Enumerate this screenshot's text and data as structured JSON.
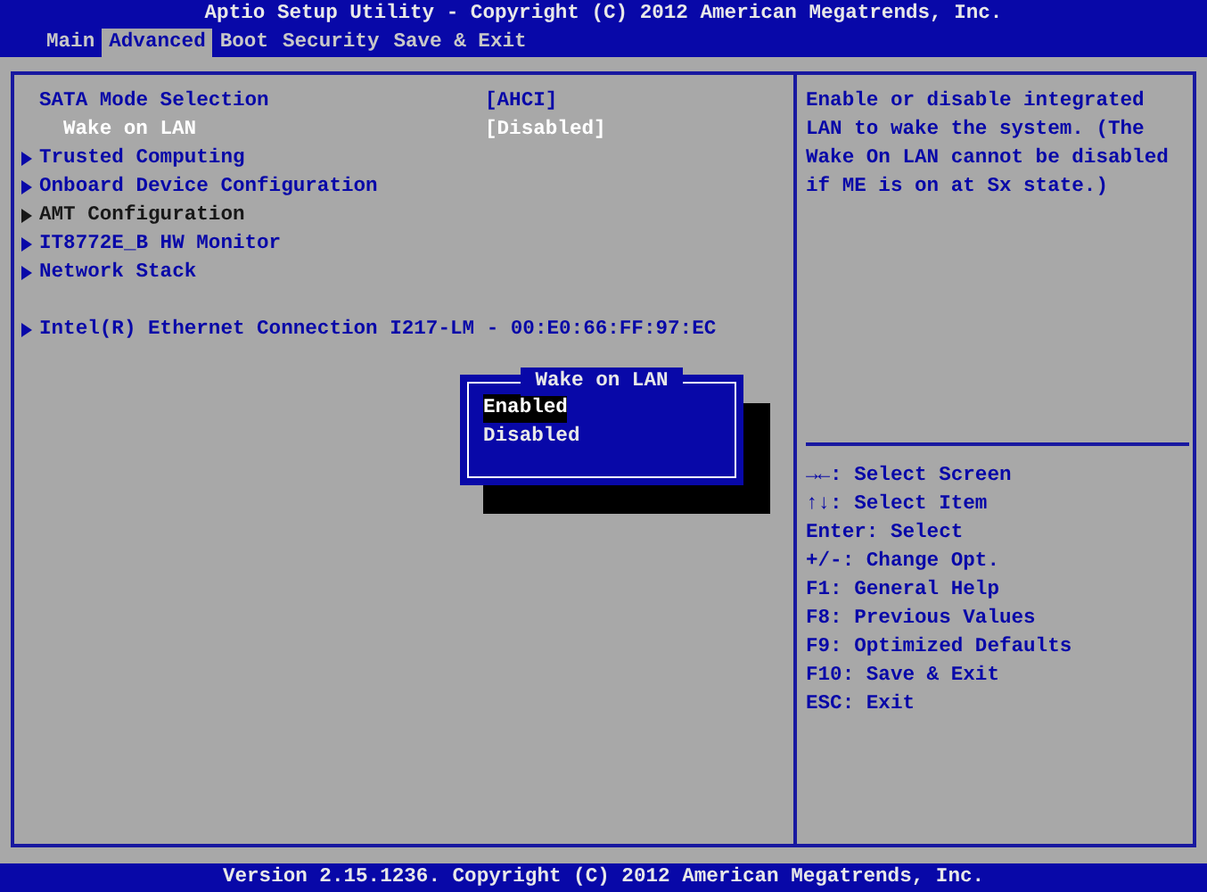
{
  "window": {
    "title": "Aptio Setup Utility - Copyright (C) 2012 American Megatrends, Inc."
  },
  "tabs": [
    {
      "label": "Main",
      "selected": false
    },
    {
      "label": "Advanced",
      "selected": true
    },
    {
      "label": "Boot",
      "selected": false
    },
    {
      "label": "Security",
      "selected": false
    },
    {
      "label": "Save & Exit",
      "selected": false
    }
  ],
  "menu": {
    "sections": [
      {
        "items": [
          {
            "kind": "setting",
            "label": "SATA Mode Selection",
            "value": "[AHCI]",
            "highlighted": false,
            "disabled": false,
            "children": [
              {
                "kind": "setting",
                "label": "Wake on LAN",
                "value": "[Disabled]",
                "highlighted": true,
                "disabled": false
              }
            ]
          },
          {
            "kind": "submenu",
            "label": "Trusted Computing",
            "highlighted": false,
            "disabled": false
          },
          {
            "kind": "submenu",
            "label": "Onboard Device Configuration",
            "highlighted": false,
            "disabled": false
          },
          {
            "kind": "submenu",
            "label": "AMT Configuration",
            "highlighted": false,
            "disabled": true
          },
          {
            "kind": "submenu",
            "label": "IT8772E_B HW Monitor",
            "highlighted": false,
            "disabled": false
          },
          {
            "kind": "submenu",
            "label": "Network Stack",
            "highlighted": false,
            "disabled": false
          }
        ]
      },
      {
        "items": [
          {
            "kind": "submenu",
            "label": "Intel(R) Ethernet Connection I217-LM - 00:E0:66:FF:97:EC",
            "highlighted": false,
            "disabled": false
          }
        ]
      }
    ]
  },
  "popup": {
    "title": "Wake on LAN",
    "options": [
      {
        "label": "Enabled",
        "selected": true
      },
      {
        "label": "Disabled",
        "selected": false
      }
    ]
  },
  "help": {
    "text": "Enable or disable integrated LAN to wake the system. (The Wake On LAN cannot be disabled if ME is on at Sx state.)",
    "keys": [
      "→←: Select Screen",
      "↑↓: Select Item",
      "Enter: Select",
      "+/-: Change Opt.",
      "F1: General Help",
      "F8: Previous Values",
      "F9: Optimized Defaults",
      "F10: Save & Exit",
      "ESC: Exit"
    ]
  },
  "status_bar": {
    "text": "Version 2.15.1236. Copyright (C) 2012 American Megatrends, Inc."
  }
}
